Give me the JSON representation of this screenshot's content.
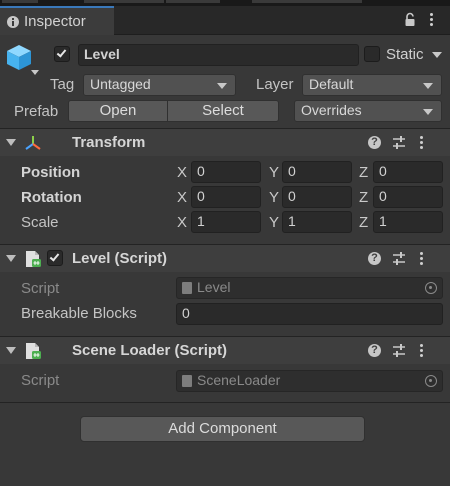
{
  "window": {
    "tab_label": "Inspector",
    "tab_icon": "info-icon",
    "lock_icon": "lock-icon",
    "menu_icon": "kebab-menu-icon"
  },
  "gameobject": {
    "active": true,
    "name": "Level",
    "static_label": "Static",
    "static_checked": false,
    "tag_label": "Tag",
    "tag_value": "Untagged",
    "layer_label": "Layer",
    "layer_value": "Default",
    "prefab_label": "Prefab",
    "open_label": "Open",
    "select_label": "Select",
    "overrides_label": "Overrides"
  },
  "transform": {
    "title": "Transform",
    "rows": [
      {
        "label": "Position",
        "x": "0",
        "y": "0",
        "z": "0"
      },
      {
        "label": "Rotation",
        "x": "0",
        "y": "0",
        "z": "0"
      },
      {
        "label": "Scale",
        "x": "1",
        "y": "1",
        "z": "1"
      }
    ],
    "axis_x": "X",
    "axis_y": "Y",
    "axis_z": "Z"
  },
  "level_script": {
    "title": "Level (Script)",
    "enabled": true,
    "script_label": "Script",
    "script_value": "Level",
    "field_label": "Breakable Blocks",
    "field_value": "0"
  },
  "scene_loader": {
    "title": "Scene Loader (Script)",
    "script_label": "Script",
    "script_value": "SceneLoader"
  },
  "add_component_label": "Add Component",
  "colors": {
    "background": "#383838",
    "header": "#3e3e3e",
    "field": "#2a2a2a",
    "accent": "#3a79bb"
  }
}
